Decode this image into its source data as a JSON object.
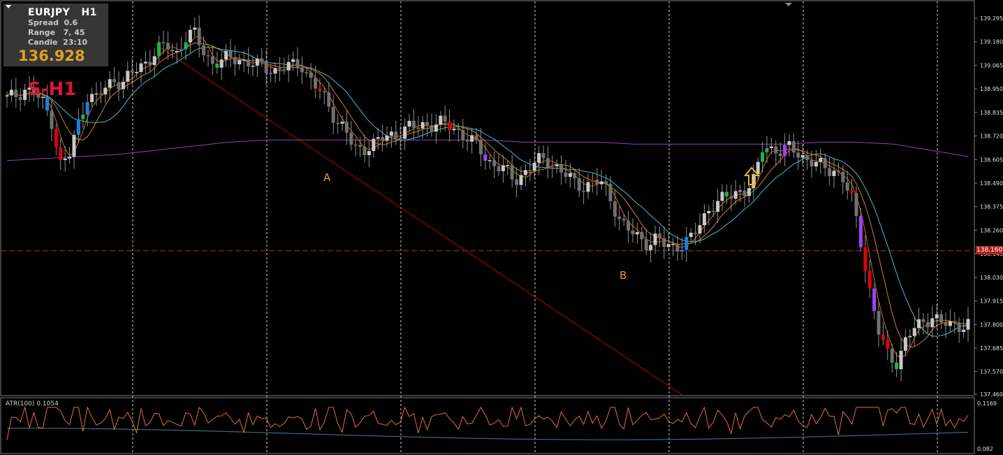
{
  "header": {
    "symbol": "EURJPY",
    "timeframe": "H1",
    "spread_label": "Spread",
    "spread_value": "0.6",
    "range_label": "Range",
    "range_value": "7, 45",
    "candle_label": "Candle",
    "candle_value": "23:10",
    "price": "136.928",
    "tf_label": "S-H1"
  },
  "annotations": {
    "point_a": "A",
    "point_b": "B"
  },
  "current_price_tag": "138.160",
  "atr_label": "ATR(100) 0.1054",
  "colors": {
    "background": "#000000",
    "grid_vertical": "#ffffff",
    "candle_neutral": "#a0a0a0",
    "candle_bear_strong": "#e00010",
    "candle_bull_strong": "#22b14c",
    "candle_blue": "#1e7fe0",
    "candle_purple": "#a040ff",
    "ma_slow": "#9a3fb0",
    "ma_teal": "#40c0d0",
    "ma_orange": "#d08020",
    "trendline": "#cc0000",
    "level_line": "#b03020",
    "atr_line": "#e07030",
    "atr_avg": "#408090",
    "annotation_text": "#e0a020",
    "arrow_up": "#f0b010"
  },
  "chart_data": [
    {
      "type": "candlestick",
      "title": "EURJPY H1",
      "y_ticks": [
        "139.295",
        "139.180",
        "139.065",
        "138.950",
        "138.835",
        "138.720",
        "138.605",
        "138.490",
        "138.375",
        "138.260",
        "138.145",
        "138.030",
        "137.915",
        "137.800",
        "137.685",
        "137.570",
        "137.460"
      ],
      "ylim": [
        137.46,
        139.295
      ],
      "level_line": 138.16,
      "close_path": [
        138.9,
        138.92,
        138.95,
        138.93,
        138.88,
        138.8,
        138.58,
        138.62,
        138.78,
        138.92,
        138.9,
        138.95,
        139.0,
        138.98,
        139.02,
        139.06,
        139.1,
        139.14,
        139.16,
        139.12,
        139.2,
        139.22,
        139.14,
        139.08,
        139.08,
        139.1,
        139.1,
        139.08,
        139.06,
        139.06,
        139.04,
        139.05,
        139.06,
        139.08,
        139.0,
        138.94,
        138.88,
        138.8,
        138.75,
        138.65,
        138.66,
        138.68,
        138.7,
        138.72,
        138.74,
        138.76,
        138.76,
        138.78,
        138.78,
        138.78,
        138.76,
        138.74,
        138.7,
        138.66,
        138.6,
        138.58,
        138.55,
        138.5,
        138.54,
        138.58,
        138.6,
        138.6,
        138.56,
        138.52,
        138.48,
        138.48,
        138.5,
        138.48,
        138.4,
        138.3,
        138.25,
        138.22,
        138.2,
        138.22,
        138.18,
        138.18,
        138.2,
        138.22,
        138.3,
        138.38,
        138.4,
        138.42,
        138.45,
        138.46,
        138.5,
        138.68,
        138.66,
        138.64,
        138.66,
        138.64,
        138.6,
        138.58,
        138.56,
        138.56,
        138.5,
        138.4,
        138.2,
        137.95,
        137.75,
        137.65,
        137.62,
        137.72,
        137.78,
        137.82,
        137.84,
        137.8,
        137.8,
        137.8,
        137.8
      ],
      "ma_slow": [
        138.6,
        138.61,
        138.62,
        138.63,
        138.65,
        138.67,
        138.69,
        138.7,
        138.7,
        138.7,
        138.7,
        138.7,
        138.7,
        138.7,
        138.69,
        138.69,
        138.69,
        138.68,
        138.68,
        138.68,
        138.68,
        138.68,
        138.69,
        138.69,
        138.68,
        138.65,
        138.62
      ],
      "atr": {
        "label": "ATR(100) 0.1054",
        "y_ticks": [
          "0.1169",
          "0.082"
        ],
        "ylim": [
          0.082,
          0.1169
        ]
      }
    }
  ]
}
